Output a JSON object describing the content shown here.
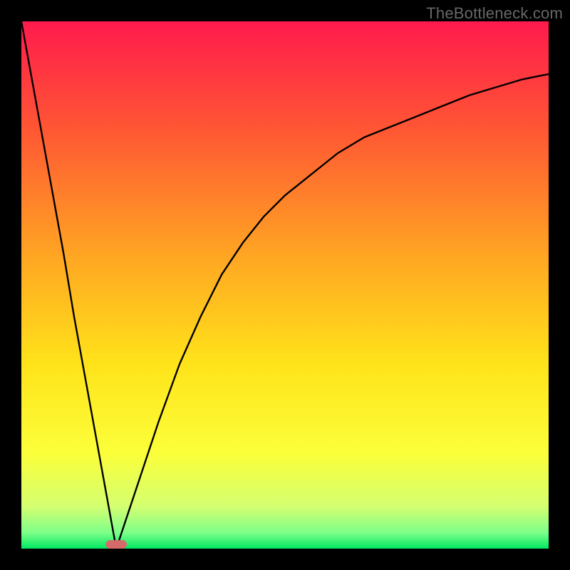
{
  "watermark": "TheBottleneck.com",
  "chart_data": {
    "type": "line",
    "title": "",
    "xlabel": "",
    "ylabel": "",
    "xlim": [
      0,
      100
    ],
    "ylim": [
      0,
      100
    ],
    "grid": false,
    "note": "Axes have no tick labels. Background is a vertical rainbow gradient (red top → green bottom). A red marker sits at the curve minimum near x≈18.",
    "gradient_stops": [
      {
        "offset": 0.0,
        "color": "#ff1a4d"
      },
      {
        "offset": 0.2,
        "color": "#ff5534"
      },
      {
        "offset": 0.45,
        "color": "#ffa722"
      },
      {
        "offset": 0.65,
        "color": "#ffe31a"
      },
      {
        "offset": 0.82,
        "color": "#fbff3a"
      },
      {
        "offset": 0.92,
        "color": "#d4ff70"
      },
      {
        "offset": 0.97,
        "color": "#7dff8a"
      },
      {
        "offset": 1.0,
        "color": "#00e862"
      }
    ],
    "series": [
      {
        "name": "left-branch",
        "x": [
          0,
          2,
          4,
          6,
          8,
          10,
          12,
          14,
          16,
          18
        ],
        "y": [
          100,
          89,
          78,
          67,
          56,
          44,
          33,
          22,
          11,
          0
        ]
      },
      {
        "name": "right-branch",
        "x": [
          18,
          22,
          26,
          30,
          34,
          38,
          42,
          46,
          50,
          55,
          60,
          65,
          70,
          75,
          80,
          85,
          90,
          95,
          100
        ],
        "y": [
          0,
          12,
          24,
          35,
          44,
          52,
          58,
          63,
          67,
          71,
          75,
          78,
          80,
          82,
          84,
          86,
          87.5,
          89,
          90
        ]
      }
    ],
    "marker": {
      "x": 18,
      "y": 0.8,
      "color": "#d66a6a",
      "width_pct": 4,
      "height_pct": 1.6
    }
  }
}
